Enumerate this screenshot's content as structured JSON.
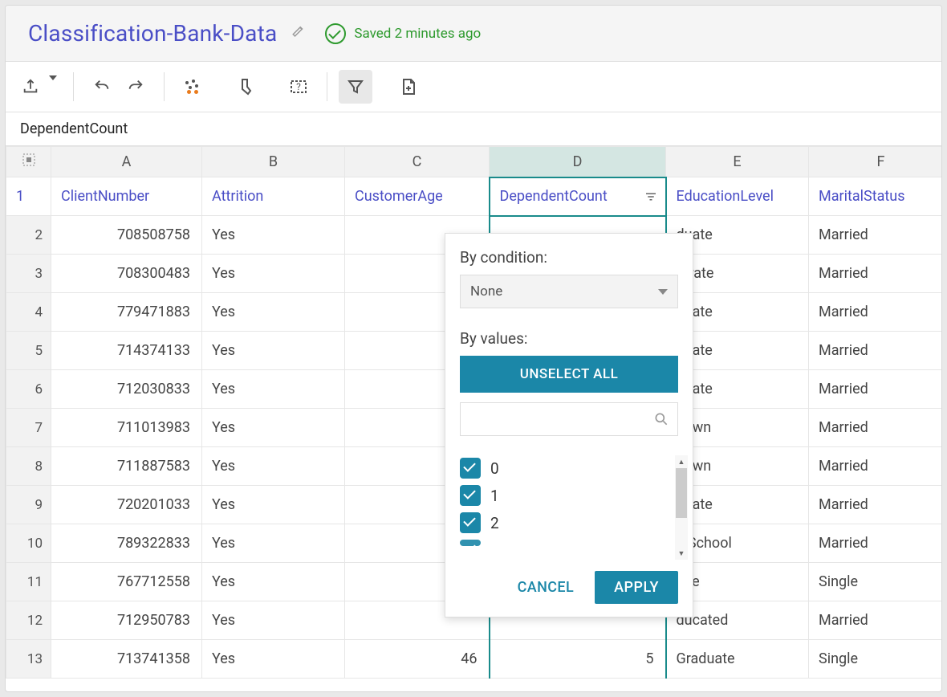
{
  "header": {
    "title": "Classification-Bank-Data",
    "save_status": "Saved 2 minutes ago"
  },
  "namebox": "DependentCount",
  "columns": {
    "letters": [
      "A",
      "B",
      "C",
      "D",
      "E",
      "F"
    ],
    "selected_letter": "D",
    "headers": [
      "ClientNumber",
      "Attrition",
      "CustomerAge",
      "DependentCount",
      "EducationLevel",
      "MaritalStatus"
    ],
    "selected_index": 3
  },
  "rows": [
    {
      "n": 2,
      "cells": [
        "708508758",
        "Yes",
        "",
        "",
        "duate",
        "Married"
      ]
    },
    {
      "n": 3,
      "cells": [
        "708300483",
        "Yes",
        "",
        "",
        "torate",
        "Married"
      ]
    },
    {
      "n": 4,
      "cells": [
        "779471883",
        "Yes",
        "",
        "",
        "duate",
        "Married"
      ]
    },
    {
      "n": 5,
      "cells": [
        "714374133",
        "Yes",
        "",
        "",
        "duate",
        "Married"
      ]
    },
    {
      "n": 6,
      "cells": [
        "712030833",
        "Yes",
        "",
        "",
        "duate",
        "Married"
      ]
    },
    {
      "n": 7,
      "cells": [
        "711013983",
        "Yes",
        "",
        "",
        "nown",
        "Married"
      ]
    },
    {
      "n": 8,
      "cells": [
        "711887583",
        "Yes",
        "",
        "",
        "nown",
        "Married"
      ]
    },
    {
      "n": 9,
      "cells": [
        "720201033",
        "Yes",
        "",
        "",
        "duate",
        "Married"
      ]
    },
    {
      "n": 10,
      "cells": [
        "789322833",
        "Yes",
        "",
        "",
        "n School",
        "Married"
      ]
    },
    {
      "n": 11,
      "cells": [
        "767712558",
        "Yes",
        "",
        "",
        "ege",
        "Single"
      ]
    },
    {
      "n": 12,
      "cells": [
        "712950783",
        "Yes",
        "",
        "",
        "ducated",
        "Married"
      ]
    },
    {
      "n": 13,
      "cells": [
        "713741358",
        "Yes",
        "46",
        "5",
        "Graduate",
        "Single"
      ]
    }
  ],
  "first_header_row": 1,
  "filter_popup": {
    "by_condition_label": "By condition:",
    "condition_value": "None",
    "by_values_label": "By values:",
    "unselect_all": "UNSELECT ALL",
    "values": [
      "0",
      "1",
      "2"
    ],
    "cancel": "CANCEL",
    "apply": "APPLY"
  }
}
